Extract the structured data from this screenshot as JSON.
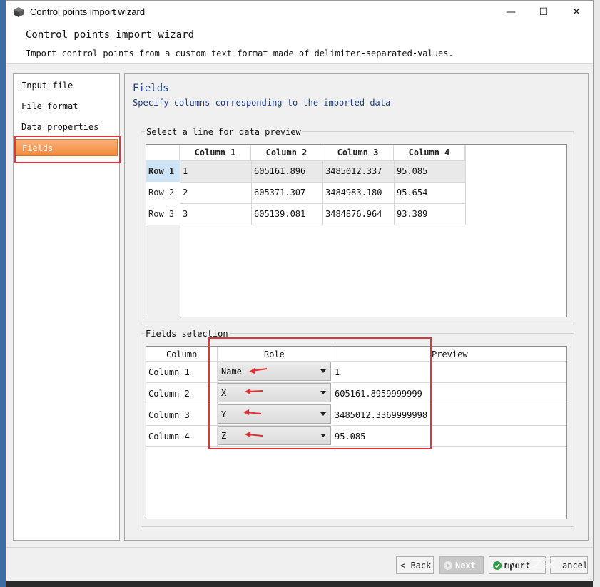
{
  "window": {
    "title": "Control points import wizard",
    "controls": {
      "minimize": "—",
      "maximize": "☐",
      "close": "✕"
    }
  },
  "header": {
    "title": "Control points import wizard",
    "subtitle": "Import control points from a custom text format made of delimiter-separated-values."
  },
  "nav": {
    "items": [
      {
        "label": "Input file",
        "active": false
      },
      {
        "label": "File format",
        "active": false
      },
      {
        "label": "Data properties",
        "active": false
      },
      {
        "label": "Fields",
        "active": true
      }
    ]
  },
  "page": {
    "title": "Fields",
    "subtitle": "Specify columns corresponding to the imported data"
  },
  "preview": {
    "group_label": "Select a line for data preview",
    "headers": [
      "Column 1",
      "Column 2",
      "Column 3",
      "Column 4"
    ],
    "rows": [
      {
        "label": "Row 1",
        "cells": [
          "1",
          "605161.896",
          "3485012.337",
          "95.085"
        ]
      },
      {
        "label": "Row 2",
        "cells": [
          "2",
          "605371.307",
          "3484983.180",
          "95.654"
        ]
      },
      {
        "label": "Row 3",
        "cells": [
          "3",
          "605139.081",
          "3484876.964",
          "93.389"
        ]
      }
    ]
  },
  "fields": {
    "group_label": "Fields selection",
    "headers": {
      "column": "Column",
      "role": "Role",
      "preview": "Preview"
    },
    "rows": [
      {
        "column": "Column 1",
        "role": "Name",
        "preview": "1"
      },
      {
        "column": "Column 2",
        "role": "X",
        "preview": "605161.8959999999"
      },
      {
        "column": "Column 3",
        "role": "Y",
        "preview": "3485012.3369999998"
      },
      {
        "column": "Column 4",
        "role": "Z",
        "preview": "95.085"
      }
    ]
  },
  "footer": {
    "back": "< Back",
    "next": "Next",
    "import": "mport",
    "cancel": "ancel",
    "watermark": "RTK之家"
  },
  "colors": {
    "accent_orange": "#f08a3c",
    "annotation_red": "#d9363e",
    "heading_blue": "#1f3f8a",
    "selection_blue": "#cde3f6"
  }
}
